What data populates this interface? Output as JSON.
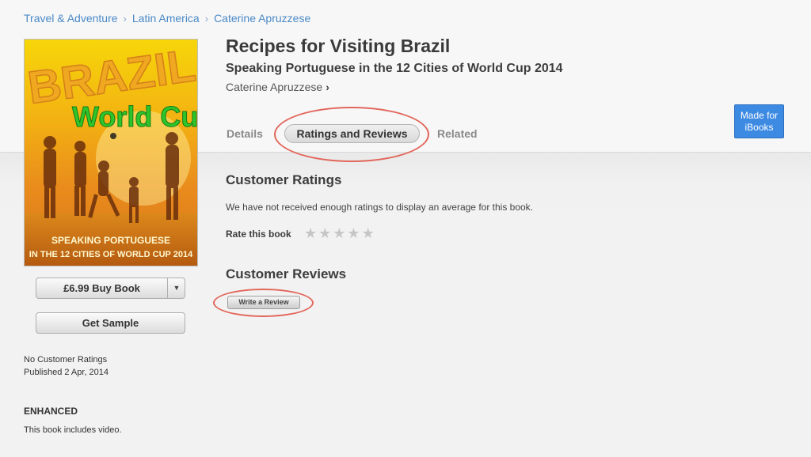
{
  "breadcrumb": [
    "Travel & Adventure",
    "Latin America",
    "Caterine Apruzzese"
  ],
  "book": {
    "title": "Recipes for Visiting Brazil",
    "subtitle": "Speaking Portuguese in the 12 Cities of World Cup 2014",
    "author": "Caterine Apruzzese",
    "cover": {
      "line1": "BRAZIL",
      "line2": "World Cup",
      "line3": "SPEAKING PORTUGUESE",
      "line4": "IN THE 12 CITIES OF WORLD CUP 2014"
    }
  },
  "tabs": [
    "Details",
    "Ratings and Reviews",
    "Related"
  ],
  "badge": {
    "line1": "Made for",
    "line2": "iBooks"
  },
  "buttons": {
    "buy": "£6.99 Buy Book",
    "sample": "Get Sample",
    "write_review": "Write a Review"
  },
  "meta": {
    "ratings": "No Customer Ratings",
    "published": "Published 2 Apr, 2014"
  },
  "enhanced": {
    "title": "ENHANCED",
    "desc": "This book includes video."
  },
  "ratings": {
    "title": "Customer Ratings",
    "note": "We have not received enough ratings to display an average for this book.",
    "rate_label": "Rate this book",
    "stars_total": 5
  },
  "reviews": {
    "title": "Customer Reviews"
  },
  "icons": {
    "chevron": "chevron-right-icon",
    "dropdown": "chevron-down-icon",
    "star": "star-icon"
  },
  "colors": {
    "link": "#4a89c8",
    "badge": "#3d8ae3",
    "annotation": "#e2675c",
    "cover_text_green": "#2ec52a"
  }
}
